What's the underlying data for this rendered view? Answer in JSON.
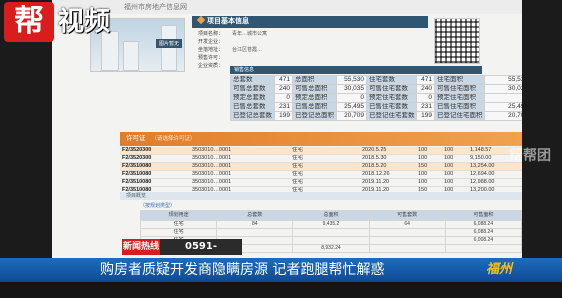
{
  "logo": {
    "badge": "帮",
    "text": "视频"
  },
  "browser": {
    "url_text": "福州市房地产信息网"
  },
  "project": {
    "photo_caption": "图片暂无",
    "header": "项目基本信息",
    "rows": [
      {
        "label": "项目名称：",
        "value": "青年…城市公寓"
      },
      {
        "label": "开发企业：",
        "value": ""
      },
      {
        "label": "坐落地址：",
        "value": "台江区苍霞…"
      },
      {
        "label": "预售许可：",
        "value": ""
      },
      {
        "label": "企业资质：",
        "value": ""
      }
    ]
  },
  "sales": {
    "header": "销售信息",
    "rows": [
      [
        "总套数",
        "471",
        "总面积",
        "55,530",
        "住宅套数",
        "471",
        "住宅面积",
        "55,530"
      ],
      [
        "可售总套数",
        "240",
        "可售总面积",
        "30,035",
        "可售住宅套数",
        "240",
        "可售住宅面积",
        "30,035"
      ],
      [
        "预定总套数",
        "0",
        "预定总面积",
        "0",
        "预定住宅套数",
        "0",
        "预定住宅面积",
        "0"
      ],
      [
        "已售总套数",
        "231",
        "已售总面积",
        "25,495",
        "已售住宅套数",
        "231",
        "已售住宅面积",
        "25,495"
      ],
      [
        "已登记总套数",
        "199",
        "已登记总面积",
        "20,709",
        "已登记住宅套数",
        "199",
        "已登记住宅面积",
        "20,709"
      ]
    ]
  },
  "license": {
    "header": "许可证",
    "note": "（请选择许可证）",
    "rows": [
      [
        "F2/3520300",
        "3503010…0001",
        "住宅",
        "2020.5.25",
        "100",
        "100",
        "1,148.57"
      ],
      [
        "F2/3520300",
        "3503010…0001",
        "住宅",
        "2018.5.30",
        "100",
        "100",
        "9,150.00"
      ],
      [
        "F2/3510080",
        "3503010…0001",
        "住宅",
        "2018.5.20",
        "150",
        "100",
        "13,254.00"
      ],
      [
        "F2/3510080",
        "3503010…0001",
        "住宅",
        "2018.12.26",
        "100",
        "100",
        "12,694.00"
      ],
      [
        "F2/3510080",
        "3503010…0001",
        "住宅",
        "2019.11.20",
        "100",
        "100",
        "12,988.00"
      ],
      [
        "F2/3510080",
        "3503010…0001",
        "住宅",
        "2019.11.20",
        "150",
        "100",
        "13,200.00"
      ]
    ]
  },
  "detail": {
    "bar_text": "项目概览",
    "tab_label": "（按规划类型）",
    "headers": [
      "规划用途",
      "总套数",
      "总面积",
      "可售套数",
      "可售面积"
    ],
    "rows": [
      [
        "住宅",
        "84",
        "9,435.2",
        "64",
        "6,088.24"
      ],
      [
        "住宅",
        "",
        "",
        "",
        "6,088.24"
      ],
      [
        "住宅",
        "",
        "",
        "",
        "6,008.24"
      ],
      [
        "商业",
        "",
        "8,932.24",
        "",
        ""
      ]
    ]
  },
  "overlay": {
    "hotline_tag": "新闻热线",
    "hotline_number": "0591-38280880",
    "headline": "购房者质疑开发商隐瞒房源    记者跑腿帮忙解惑",
    "city": "福州",
    "watermark": "帮帮团"
  }
}
